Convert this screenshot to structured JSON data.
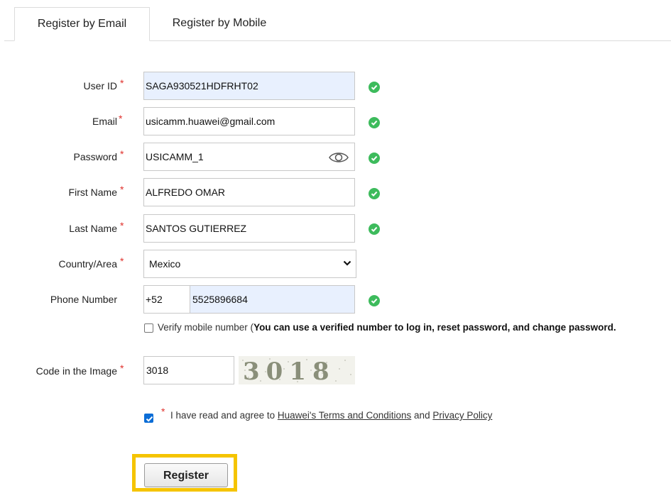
{
  "tabs": [
    {
      "label": "Register by Email",
      "active": true
    },
    {
      "label": "Register by Mobile",
      "active": false
    }
  ],
  "form": {
    "user_id": {
      "label": "User ID",
      "value": "SAGA930521HDFRHT02",
      "valid": true
    },
    "email": {
      "label": "Email",
      "value": "usicamm.huawei@gmail.com",
      "valid": true
    },
    "password": {
      "label": "Password",
      "value": "USICAMM_1",
      "valid": true,
      "icon": "eye-icon"
    },
    "first_name": {
      "label": "First Name",
      "value": "ALFREDO OMAR",
      "valid": true
    },
    "last_name": {
      "label": "Last Name",
      "value": "SANTOS GUTIERREZ",
      "valid": true
    },
    "country": {
      "label": "Country/Area",
      "value": "Mexico"
    },
    "phone": {
      "label": "Phone Number",
      "code": "+52",
      "value": "5525896684",
      "valid": true
    },
    "verify_mobile": {
      "checked": false,
      "prefix": "Verify mobile number (",
      "bold": "You can use a verified number to log in, reset password, and change password."
    },
    "captcha": {
      "label": "Code in the Image",
      "value": "3018",
      "image_text": "3018"
    },
    "agree": {
      "checked": true,
      "prefix": "I have read and agree to ",
      "terms_link": "Huawei's Terms and Conditions",
      "middle": " and ",
      "privacy_link": "Privacy Policy"
    },
    "required_mark": "*"
  },
  "register_button": "Register",
  "colors": {
    "accent_check": "#3dbb5c",
    "required": "#e0312c",
    "highlight_frame": "#f5c400",
    "autofill_bg": "#e8f0fe",
    "checkbox_checked": "#0b6dd6"
  }
}
